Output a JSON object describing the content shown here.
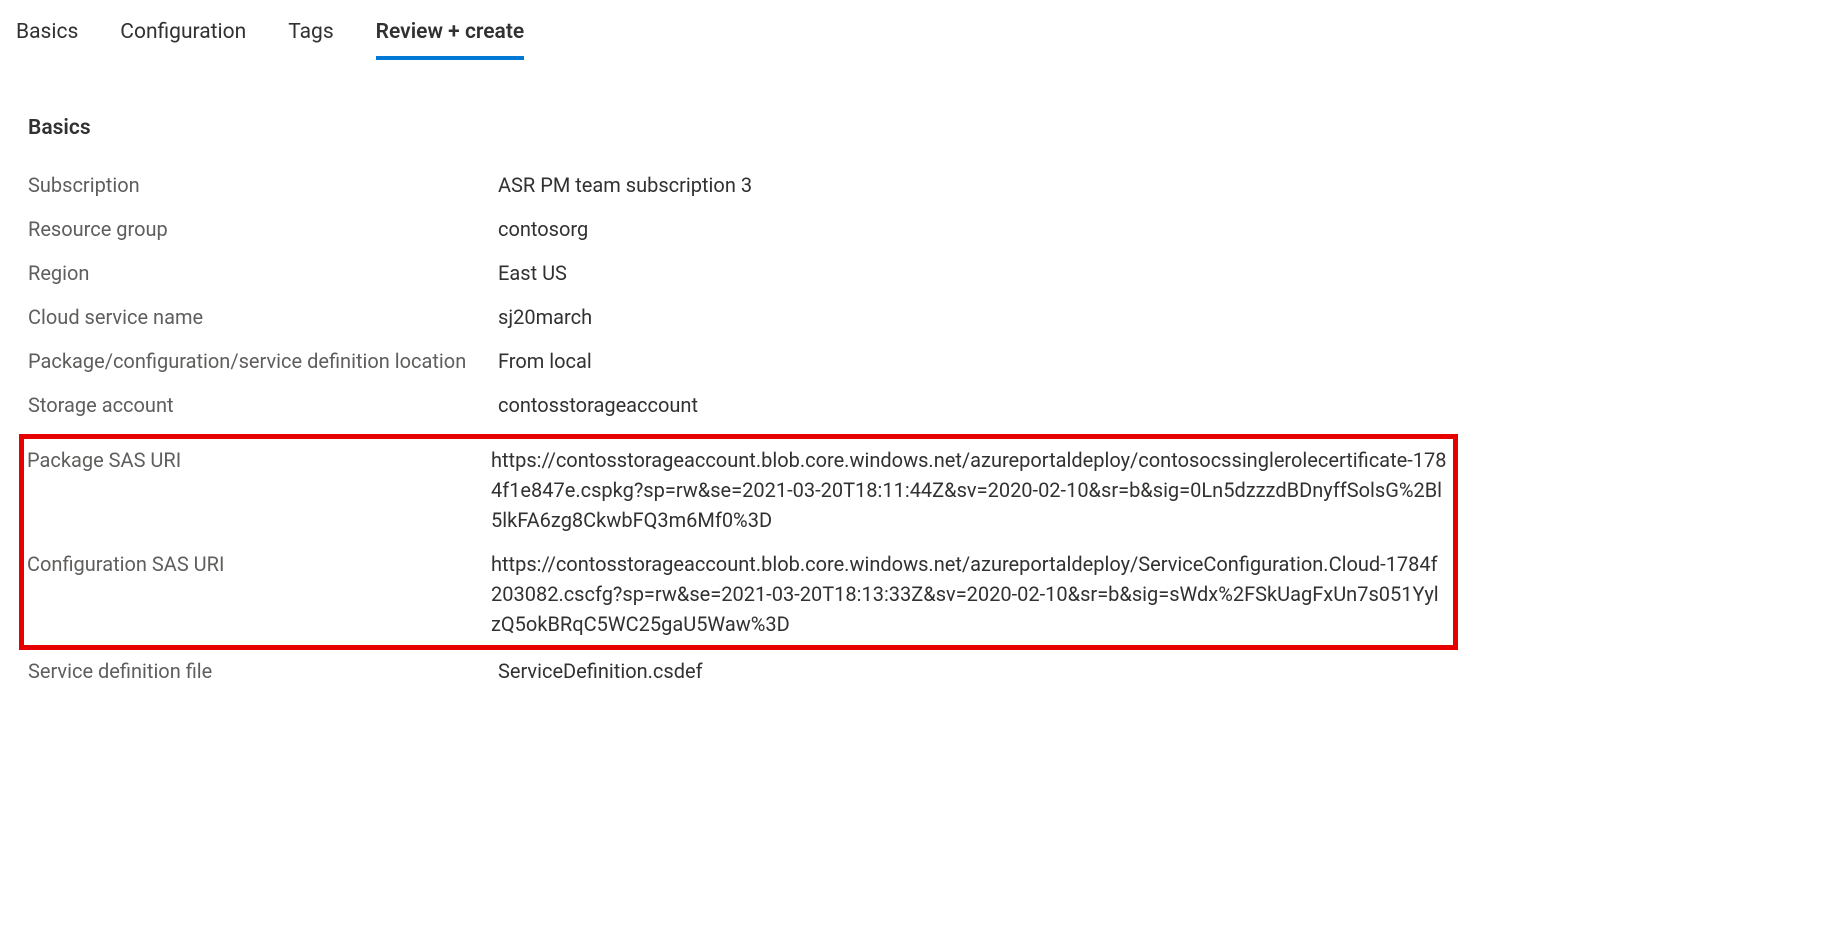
{
  "tabs": {
    "basics": "Basics",
    "configuration": "Configuration",
    "tags": "Tags",
    "review_create": "Review + create"
  },
  "section": {
    "title": "Basics"
  },
  "fields": {
    "subscription": {
      "label": "Subscription",
      "value": "ASR PM team subscription 3"
    },
    "resource_group": {
      "label": "Resource group",
      "value": "contosorg"
    },
    "region": {
      "label": "Region",
      "value": "East US"
    },
    "cloud_service_name": {
      "label": "Cloud service name",
      "value": "sj20march"
    },
    "package_location": {
      "label": "Package/configuration/service definition location",
      "value": "From local"
    },
    "storage_account": {
      "label": "Storage account",
      "value": "contosstorageaccount"
    },
    "package_sas_uri": {
      "label": "Package SAS URI",
      "value": "https://contosstorageaccount.blob.core.windows.net/azureportaldeploy/contosocssinglerolecertificate-1784f1e847e.cspkg?sp=rw&se=2021-03-20T18:11:44Z&sv=2020-02-10&sr=b&sig=0Ln5dzzzdBDnyffSolsG%2Bl5lkFA6zg8CkwbFQ3m6Mf0%3D"
    },
    "configuration_sas_uri": {
      "label": "Configuration SAS URI",
      "value": "https://contosstorageaccount.blob.core.windows.net/azureportaldeploy/ServiceConfiguration.Cloud-1784f203082.cscfg?sp=rw&se=2021-03-20T18:13:33Z&sv=2020-02-10&sr=b&sig=sWdx%2FSkUagFxUn7s051YylzQ5okBRqC5WC25gaU5Waw%3D"
    },
    "service_definition_file": {
      "label": "Service definition file",
      "value": "ServiceDefinition.csdef"
    }
  }
}
